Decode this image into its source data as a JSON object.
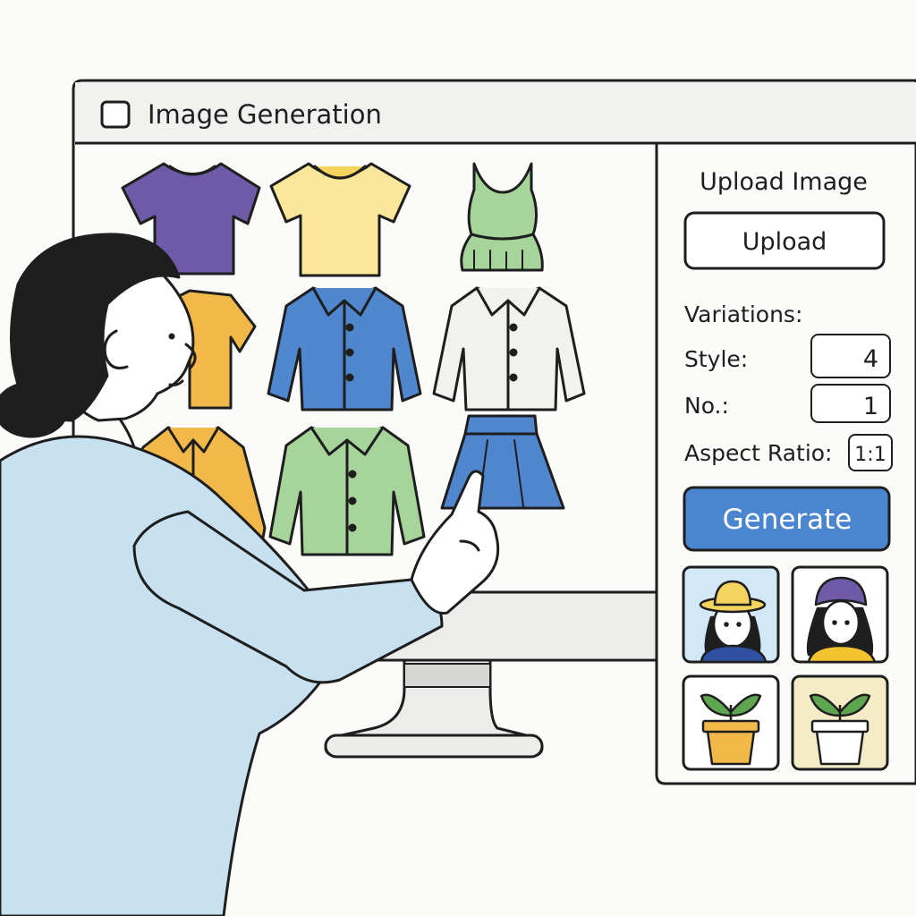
{
  "window": {
    "title": "Image Generation"
  },
  "panel": {
    "upload_heading": "Upload Image",
    "upload_button": "Upload",
    "variations_label": "Variations:",
    "style_label": "Style:",
    "style_value": "4",
    "count_label": "No.:",
    "count_value": "1",
    "aspect_label": "Aspect Ratio:",
    "aspect_value": "1:1",
    "generate_button": "Generate"
  },
  "colors": {
    "generate": "#4a86d0",
    "purple": "#6e5aa6",
    "yellow": "#fbe79a",
    "green": "#a7d49a",
    "orange": "#f2b94a",
    "blue": "#4f86cd",
    "white": "#f1f1ee",
    "sleeve": "#c7e1f0"
  },
  "grid_items": [
    {
      "icon": "purple-tshirt-icon"
    },
    {
      "icon": "yellow-tshirt-icon"
    },
    {
      "icon": "green-tank-top-icon"
    },
    {
      "icon": "orange-tshirt-icon"
    },
    {
      "icon": "blue-shirt-icon"
    },
    {
      "icon": "white-shirt-icon"
    },
    {
      "icon": "orange-shirt-icon"
    },
    {
      "icon": "green-shirt-icon"
    },
    {
      "icon": "blue-skirt-icon"
    }
  ],
  "results": [
    {
      "icon": "woman-hat-icon"
    },
    {
      "icon": "woman-beanie-icon"
    },
    {
      "icon": "plant-orange-pot-icon"
    },
    {
      "icon": "plant-white-pot-icon"
    }
  ]
}
